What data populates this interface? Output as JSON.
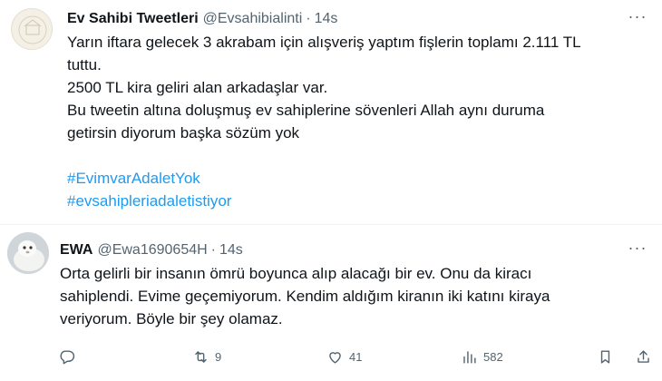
{
  "tweet1": {
    "author_name": "Ev Sahibi Tweetleri",
    "handle": "@Evsahibialinti",
    "separator": "·",
    "time": "14s",
    "lines": [
      "Yarın iftara gelecek 3 akrabam için alışveriş yaptım fişlerin toplamı 2.111 TL",
      "tuttu.",
      "2500 TL kira geliri alan arkadaşlar var.",
      "Bu tweetin altına doluşmuş ev sahiplerine sövenleri Allah aynı duruma",
      "getirsin diyorum başka sözüm yok"
    ],
    "hashtags": [
      "#EvimvarAdaletYok",
      "#evsahipleriadaletistiyor"
    ],
    "more_icon": "ellipsis-icon"
  },
  "tweet2": {
    "author_name": "EWA",
    "handle": "@Ewa1690654H",
    "separator": "·",
    "time": "14s",
    "lines": [
      "Orta gelirli bir insanın ömrü boyunca alıp alacağı bir ev. Onu da kiracı",
      "sahiplendi. Evime geçemiyorum. Kendim aldığım kiranın iki katını kiraya",
      "veriyorum. Böyle bir şey olamaz."
    ],
    "more_icon": "ellipsis-icon",
    "actions": {
      "reply_count": "",
      "retweet_count": "9",
      "like_count": "41",
      "views_count": "582",
      "share_count": ""
    }
  },
  "colors": {
    "text": "#0f1419",
    "secondary": "#536471",
    "hashtag": "#1d9bf0",
    "divider": "#eff3f4"
  }
}
